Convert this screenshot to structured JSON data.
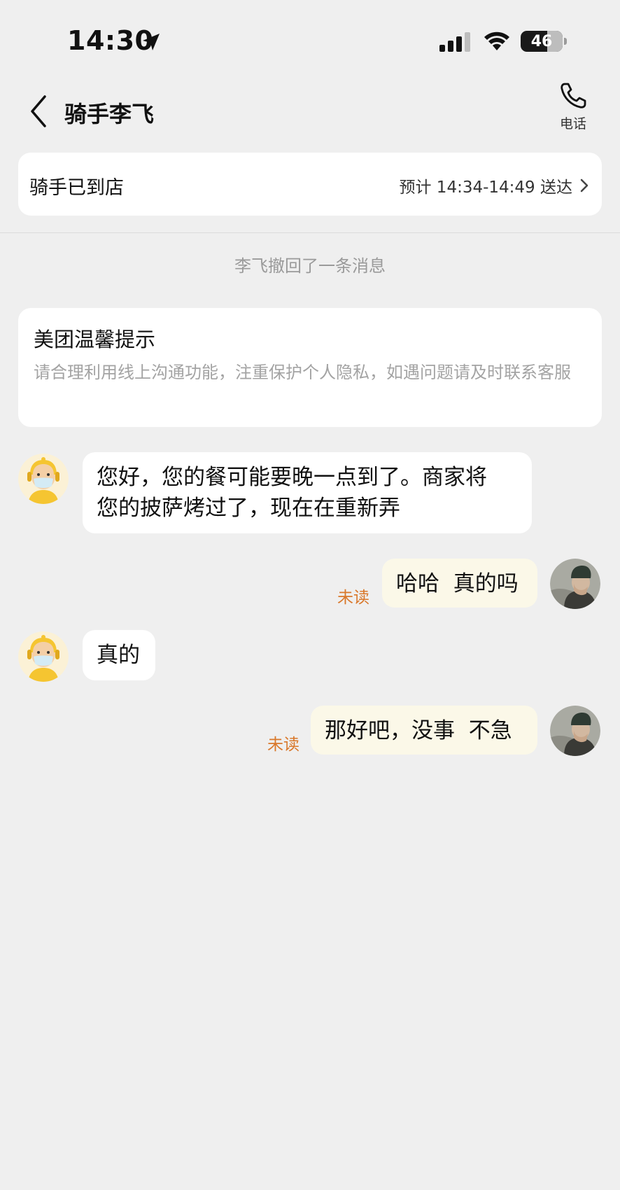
{
  "status_bar": {
    "time": "14:30",
    "battery": "46"
  },
  "nav": {
    "title": "骑手李飞",
    "phone_label": "电话"
  },
  "delivery_status": {
    "status": "骑手已到店",
    "eta": "预计 14:34-14:49 送达"
  },
  "recall_notice": "李飞撤回了一条消息",
  "tip": {
    "title": "美团温馨提示",
    "body": "请合理利用线上沟通功能，注重保护个人隐私，如遇问题请及时联系客服"
  },
  "messages": [
    {
      "from": "rider",
      "lines": [
        "您好，您的餐可能要晚一点到了。商家将",
        "您的披萨烤过了，现在在重新弄"
      ]
    },
    {
      "from": "me",
      "text": "哈哈  真的吗",
      "status": "未读"
    },
    {
      "from": "rider",
      "text": "真的"
    },
    {
      "from": "me",
      "text": "那好吧，没事  不急",
      "status": "未读"
    }
  ],
  "colors": {
    "background": "#efefef",
    "card": "#ffffff",
    "outgoing_bubble": "#fbf8e8",
    "unread": "#d9782b",
    "muted_text": "#9a9a9a"
  },
  "icons": [
    "location-arrow-icon",
    "signal-icon",
    "wifi-icon",
    "battery-icon",
    "back-icon",
    "phone-icon",
    "chevron-right-icon"
  ]
}
